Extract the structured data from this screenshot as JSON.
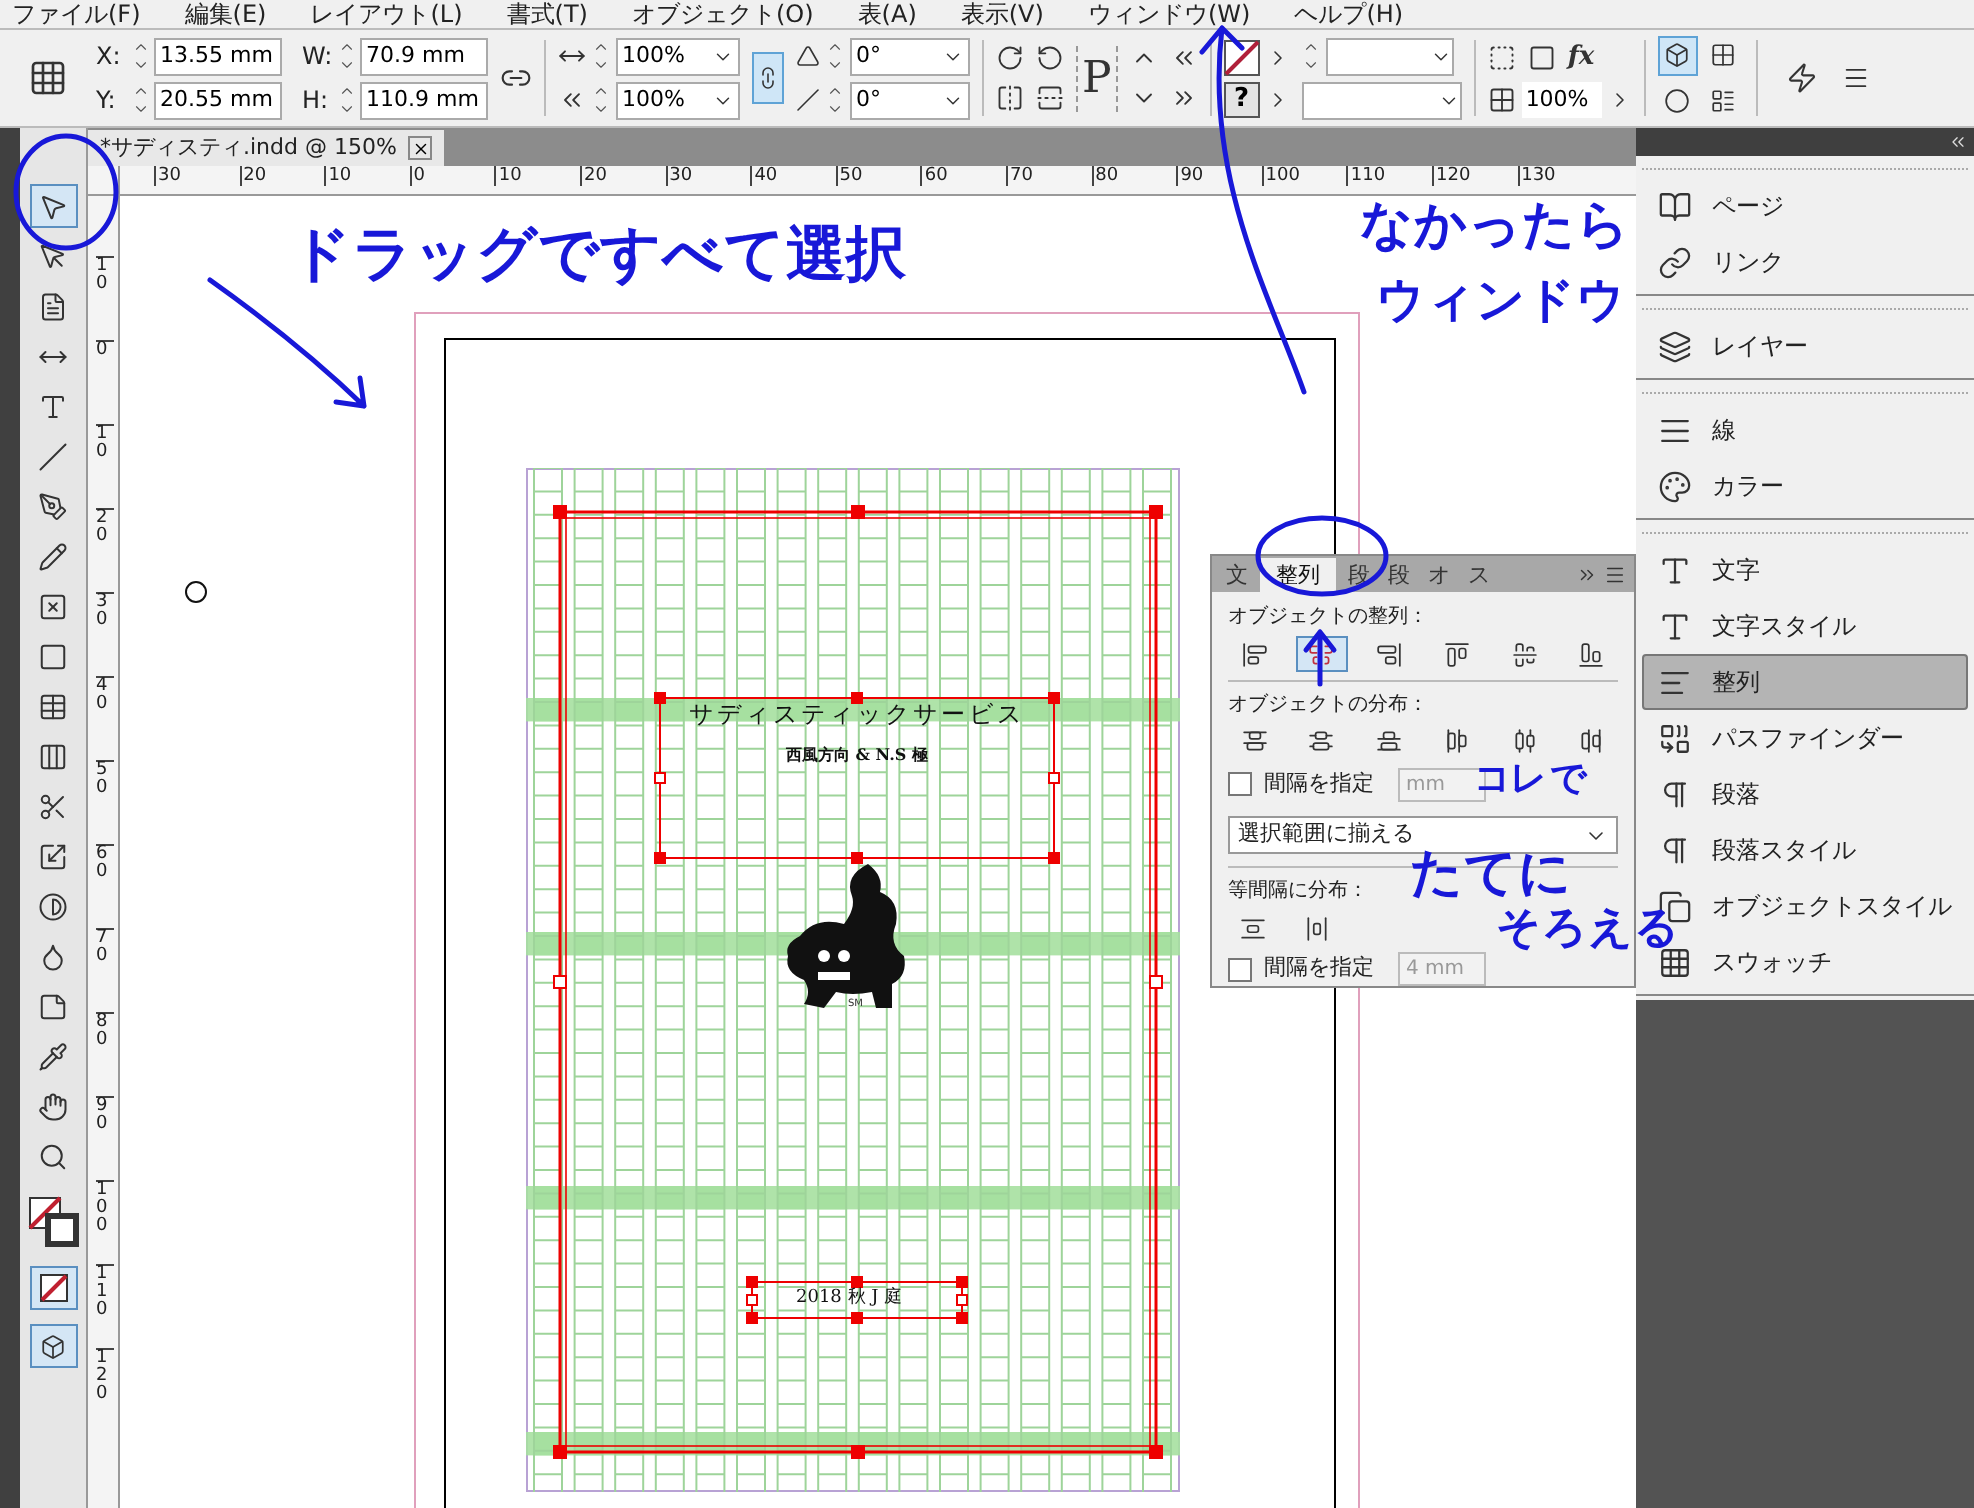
{
  "menu_bar": [
    "ファイル(F)",
    "編集(E)",
    "レイアウト(L)",
    "書式(T)",
    "オブジェクト(O)",
    "表(A)",
    "表示(V)",
    "ウィンドウ(W)",
    "ヘルプ(H)"
  ],
  "control_bar": {
    "fields": [
      {
        "label": "X:",
        "value": "13.55 mm"
      },
      {
        "label": "Y:",
        "value": "20.55 mm"
      },
      {
        "label": "W:",
        "value": "70.9 mm"
      },
      {
        "label": "H:",
        "value": "110.9 mm"
      }
    ],
    "scale": [
      "100%",
      "100%"
    ],
    "constrain_proportions": true,
    "angles": [
      "0°",
      "0°"
    ],
    "frame_glyph": "P",
    "help_glyph": "?",
    "effects_glyph": "fx",
    "opacity": "100%",
    "wrap_options": [
      {
        "selected": true
      },
      {
        "selected": false
      },
      {
        "selected": false
      },
      {
        "selected": false
      }
    ]
  },
  "document_tab": {
    "title": "*サディスティ.indd @ 150%"
  },
  "ruler_labels": [
    "30",
    "20",
    "10",
    "0",
    "10",
    "20",
    "30",
    "40",
    "50",
    "60",
    "70",
    "80",
    "90",
    "100",
    "110",
    "120",
    "130"
  ],
  "vertical_ruler_labels": [
    "10",
    "0",
    "10",
    "20",
    "30",
    "40",
    "50",
    "60",
    "70",
    "80",
    "90",
    "100",
    "110",
    "120"
  ],
  "tools": [
    {
      "kind": "selection",
      "selected": true
    },
    {
      "kind": "direct-selection",
      "selected": false
    },
    {
      "kind": "page",
      "selected": false
    },
    {
      "kind": "gap",
      "selected": false
    },
    {
      "kind": "type",
      "selected": false
    },
    {
      "kind": "line",
      "selected": false
    },
    {
      "kind": "pen",
      "selected": false
    },
    {
      "kind": "pencil",
      "selected": false
    },
    {
      "kind": "rectangle-frame",
      "selected": false
    },
    {
      "kind": "rectangle",
      "selected": false
    },
    {
      "kind": "table",
      "selected": false
    },
    {
      "kind": "columns",
      "selected": false
    },
    {
      "kind": "scissors",
      "selected": false
    },
    {
      "kind": "free-transform",
      "selected": false
    },
    {
      "kind": "gradient",
      "selected": false
    },
    {
      "kind": "gradient-feather",
      "selected": false
    },
    {
      "kind": "note",
      "selected": false
    },
    {
      "kind": "eyedropper",
      "selected": false
    },
    {
      "kind": "hand",
      "selected": false
    },
    {
      "kind": "zoom",
      "selected": false
    }
  ],
  "page": {
    "title": "サディスティックサービス",
    "subtitle": "西風方向 & N.S 極",
    "signature": "SM",
    "footer": "2018 秋 J 庭"
  },
  "align_panel": {
    "tabs": [
      {
        "label": "文",
        "selected": false
      },
      {
        "label": "整列",
        "selected": true
      },
      {
        "label": "段",
        "selected": false
      },
      {
        "label": "段",
        "selected": false
      },
      {
        "label": "オ",
        "selected": false
      },
      {
        "label": "ス",
        "selected": false
      }
    ],
    "align_label": "オブジェクトの整列：",
    "align_buttons": [
      {
        "kind": "left",
        "selected": false
      },
      {
        "kind": "h-center",
        "selected": true
      },
      {
        "kind": "right",
        "selected": false
      },
      {
        "kind": "top",
        "selected": false
      },
      {
        "kind": "v-center",
        "selected": false
      },
      {
        "kind": "bottom",
        "selected": false
      }
    ],
    "distribute_label": "オブジェクトの分布：",
    "distribute_buttons": [
      {
        "kind": "top"
      },
      {
        "kind": "v-center"
      },
      {
        "kind": "bottom"
      },
      {
        "kind": "left"
      },
      {
        "kind": "h-center"
      },
      {
        "kind": "right"
      }
    ],
    "spacing_1": {
      "label": "間隔を指定",
      "checked": false,
      "value": "mm"
    },
    "align_to": "選択範囲に揃える",
    "distribute_spacing_label": "等間隔に分布：",
    "spacing_buttons": [
      {
        "kind": "vertical"
      },
      {
        "kind": "horizontal"
      }
    ],
    "spacing_2": {
      "label": "間隔を指定",
      "checked": false,
      "value": "4 mm"
    }
  },
  "panels": [
    [
      {
        "kind": "pages",
        "label": "ページ",
        "selected": false
      },
      {
        "kind": "links",
        "label": "リンク",
        "selected": false
      }
    ],
    [
      {
        "kind": "layers",
        "label": "レイヤー",
        "selected": false
      }
    ],
    [
      {
        "kind": "stroke",
        "label": "線",
        "selected": false
      },
      {
        "kind": "color",
        "label": "カラー",
        "selected": false
      }
    ],
    [
      {
        "kind": "character",
        "label": "文字",
        "selected": false
      },
      {
        "kind": "character-style",
        "label": "文字スタイル",
        "selected": false
      },
      {
        "kind": "align",
        "label": "整列",
        "selected": true
      },
      {
        "kind": "pathfinder",
        "label": "パスファインダー",
        "selected": false
      },
      {
        "kind": "paragraph",
        "label": "段落",
        "selected": false
      },
      {
        "kind": "paragraph-style",
        "label": "段落スタイル",
        "selected": false
      },
      {
        "kind": "object-style",
        "label": "オブジェクトスタイル",
        "selected": false
      },
      {
        "kind": "swatches",
        "label": "スウォッチ",
        "selected": false
      }
    ]
  ],
  "annotations": [
    "ドラッグですべて選択",
    "なかったら",
    "ウィンドウ",
    "コレ",
    "で",
    "たてに",
    "そろえる"
  ]
}
